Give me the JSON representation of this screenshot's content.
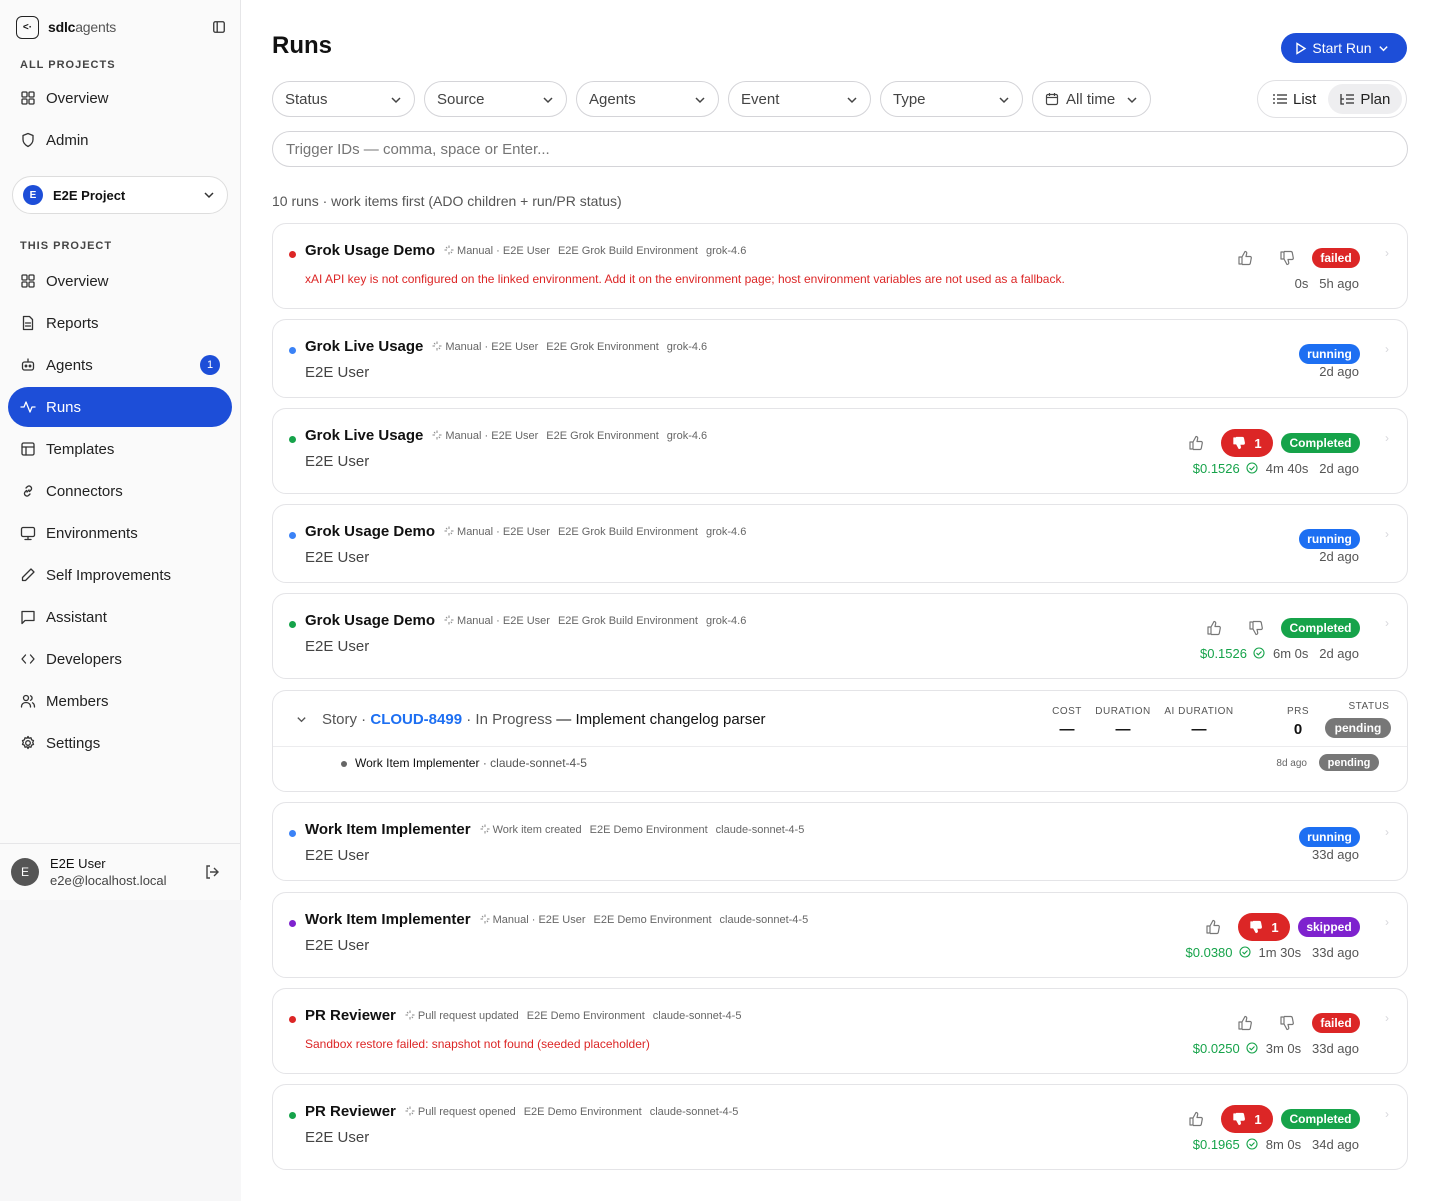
{
  "brand": {
    "a": "sdlc",
    "b": "agents"
  },
  "sidebar": {
    "all_projects_label": "ALL PROJECTS",
    "global_items": [
      {
        "label": "Overview",
        "icon": "grid-icon"
      },
      {
        "label": "Admin",
        "icon": "shield-icon"
      }
    ],
    "project": {
      "avatar": "E",
      "name": "E2E Project"
    },
    "this_project_label": "THIS PROJECT",
    "items": [
      {
        "label": "Overview",
        "icon": "grid-icon"
      },
      {
        "label": "Reports",
        "icon": "file-icon"
      },
      {
        "label": "Agents",
        "icon": "bot-icon",
        "count": "1"
      },
      {
        "label": "Runs",
        "icon": "activity-icon",
        "active": true
      },
      {
        "label": "Templates",
        "icon": "table-icon"
      },
      {
        "label": "Connectors",
        "icon": "link-icon"
      },
      {
        "label": "Environments",
        "icon": "monitor-icon"
      },
      {
        "label": "Self Improvements",
        "icon": "pen-icon"
      },
      {
        "label": "Assistant",
        "icon": "chat-icon"
      },
      {
        "label": "Developers",
        "icon": "code-icon"
      },
      {
        "label": "Members",
        "icon": "users-icon"
      },
      {
        "label": "Settings",
        "icon": "gear-icon"
      }
    ],
    "user": {
      "avatar": "E",
      "name": "E2E User",
      "email": "e2e@localhost.local"
    }
  },
  "header": {
    "title": "Runs",
    "start_label": "Start Run"
  },
  "filters": [
    "Status",
    "Source",
    "Agents",
    "Event",
    "Type"
  ],
  "time_filter": "All time",
  "view_toggle": {
    "list": "List",
    "plan": "Plan"
  },
  "trigger_placeholder": "Trigger IDs — comma, space or Enter...",
  "summary": "10 runs · work items first (ADO children + run/PR status)",
  "colors": {
    "accent": "#1d4ed8",
    "failed": "#dc2626",
    "running": "#1d6ff2",
    "completed": "#16a34a",
    "skipped": "#7e22ce"
  },
  "runs": [
    {
      "name": "Grok Usage Demo",
      "source": "Manual · E2E User",
      "env": "E2E Grok Build Environment",
      "model": "grok-4.6",
      "error": "xAI API key is not configured on the linked environment. Add it on the environment page; host environment variables are not used as a fallback.",
      "status": "failed",
      "duration": "0s",
      "ago": "5h ago"
    },
    {
      "name": "Grok Live Usage",
      "source": "Manual · E2E User",
      "env": "E2E Grok Environment",
      "model": "grok-4.6",
      "user": "E2E User",
      "status": "running",
      "ago": "2d ago"
    },
    {
      "name": "Grok Live Usage",
      "source": "Manual · E2E User",
      "env": "E2E Grok Environment",
      "model": "grok-4.6",
      "user": "E2E User",
      "status": "Completed",
      "neg": "1",
      "cost": "$0.1526",
      "duration": "4m 40s",
      "ago": "2d ago"
    },
    {
      "name": "Grok Usage Demo",
      "source": "Manual · E2E User",
      "env": "E2E Grok Build Environment",
      "model": "grok-4.6",
      "user": "E2E User",
      "status": "running",
      "ago": "2d ago"
    },
    {
      "name": "Grok Usage Demo",
      "source": "Manual · E2E User",
      "env": "E2E Grok Build Environment",
      "model": "grok-4.6",
      "user": "E2E User",
      "status": "Completed",
      "cost": "$0.1526",
      "duration": "6m 0s",
      "ago": "2d ago"
    },
    {
      "name": "Work Item Implementer",
      "source": "Work item created",
      "env": "E2E Demo Environment",
      "model": "claude-sonnet-4-5",
      "user": "E2E User",
      "status": "running",
      "ago": "33d ago"
    },
    {
      "name": "Work Item Implementer",
      "source": "Manual · E2E User",
      "env": "E2E Demo Environment",
      "model": "claude-sonnet-4-5",
      "user": "E2E User",
      "status": "skipped",
      "neg": "1",
      "cost": "$0.0380",
      "duration": "1m 30s",
      "ago": "33d ago"
    },
    {
      "name": "PR Reviewer",
      "source": "Pull request updated",
      "env": "E2E Demo Environment",
      "model": "claude-sonnet-4-5",
      "error": "Sandbox restore failed: snapshot not found (seeded placeholder)",
      "status": "failed",
      "cost": "$0.0250",
      "duration": "3m 0s",
      "ago": "33d ago"
    },
    {
      "name": "PR Reviewer",
      "source": "Pull request opened",
      "env": "E2E Demo Environment",
      "model": "claude-sonnet-4-5",
      "user": "E2E User",
      "status": "Completed",
      "neg": "1",
      "cost": "$0.1965",
      "duration": "8m 0s",
      "ago": "34d ago"
    }
  ],
  "story": {
    "type": "Story",
    "key": "CLOUD-8499",
    "state": "In Progress",
    "title": "— Implement changelog parser",
    "columns": {
      "cost": "COST",
      "duration": "DURATION",
      "ai_duration": "AI DURATION",
      "prs": "PRS",
      "status": "STATUS"
    },
    "values": {
      "cost": "—",
      "duration": "—",
      "ai_duration": "—",
      "prs": "0",
      "status": "pending"
    },
    "child": {
      "name": "Work Item Implementer",
      "model": "· claude-sonnet-4-5",
      "ago": "8d ago",
      "status": "pending"
    }
  }
}
